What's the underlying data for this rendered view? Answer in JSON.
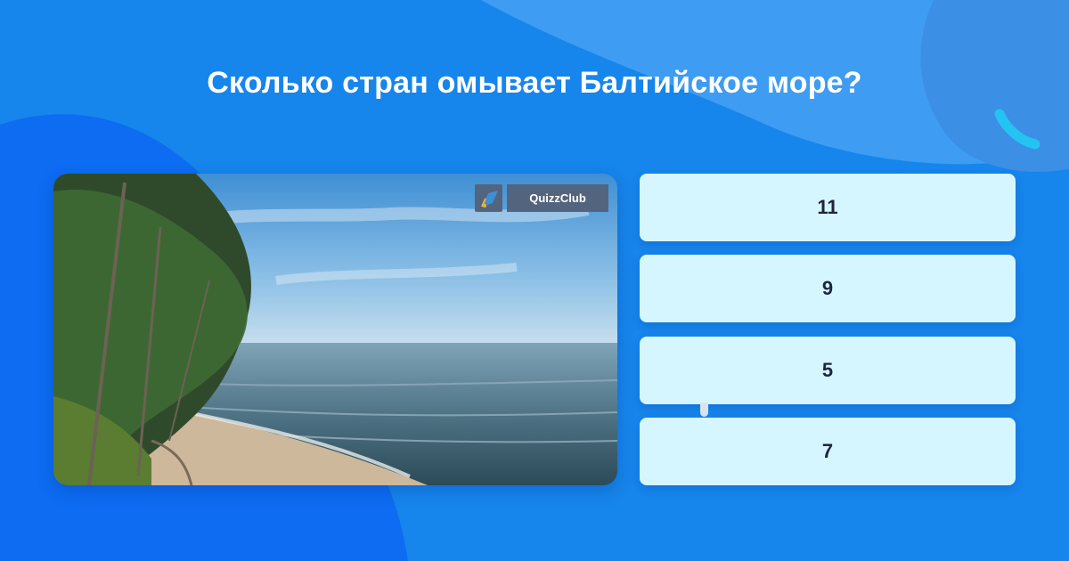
{
  "question": "Сколько стран омывает Балтийское море?",
  "badge": {
    "icon": "graduation-cap-icon",
    "label": "QuizzClub"
  },
  "answers": [
    "11",
    "9",
    "5",
    "7"
  ],
  "colors": {
    "background": "#1685ec",
    "answer_background": "#d6f6ff",
    "answer_text": "#1c2540",
    "accent": "#23c4f2"
  }
}
